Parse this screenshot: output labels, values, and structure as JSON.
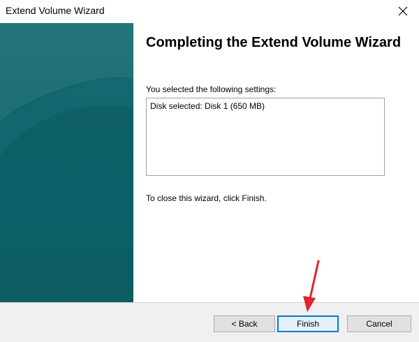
{
  "window": {
    "title": "Extend Volume Wizard"
  },
  "main": {
    "heading": "Completing the Extend Volume Wizard",
    "settings_label": "You selected the following settings:",
    "settings_lines": [
      "Disk selected: Disk 1 (650 MB)"
    ],
    "close_hint": "To close this wizard, click Finish."
  },
  "footer": {
    "back_label": "< Back",
    "finish_label": "Finish",
    "cancel_label": "Cancel"
  },
  "colors": {
    "panel": "#0f5f66",
    "accent_arrow": "#e0242a",
    "default_button_border": "#0078d7"
  },
  "icons": [
    "close-icon",
    "annotation-arrow-icon"
  ]
}
